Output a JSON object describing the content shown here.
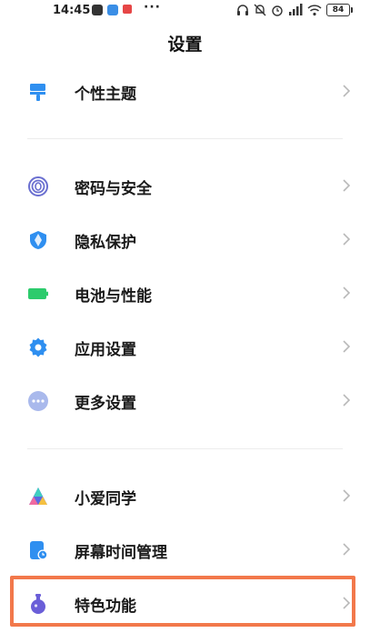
{
  "status_bar": {
    "time": "14:45",
    "more": "···",
    "battery": "84"
  },
  "header": {
    "title": "设置"
  },
  "items": [
    {
      "id": "theme",
      "label": "个性主题",
      "icon": "paint-brush-icon",
      "color": "#2f8ff0"
    },
    {
      "id": "security",
      "label": "密码与安全",
      "icon": "fingerprint-icon",
      "color": "#6a6fd0"
    },
    {
      "id": "privacy",
      "label": "隐私保护",
      "icon": "shield-icon",
      "color": "#2f8ff0"
    },
    {
      "id": "battery",
      "label": "电池与性能",
      "icon": "battery-icon",
      "color": "#2ccb6c"
    },
    {
      "id": "apps",
      "label": "应用设置",
      "icon": "gear-icon",
      "color": "#2f8ff0"
    },
    {
      "id": "more",
      "label": "更多设置",
      "icon": "more-dots-icon",
      "color": "#8ea6e8"
    },
    {
      "id": "xiaoai",
      "label": "小爱同学",
      "icon": "xiaoai-icon",
      "color": "#5a6ae0"
    },
    {
      "id": "screen_time",
      "label": "屏幕时间管理",
      "icon": "hourglass-clock-icon",
      "color": "#2f8ff0"
    },
    {
      "id": "features",
      "label": "特色功能",
      "icon": "flask-icon",
      "color": "#6a5ed8"
    }
  ],
  "colors": {
    "highlight": "#f2784b",
    "chevron": "#b8b8b8"
  }
}
